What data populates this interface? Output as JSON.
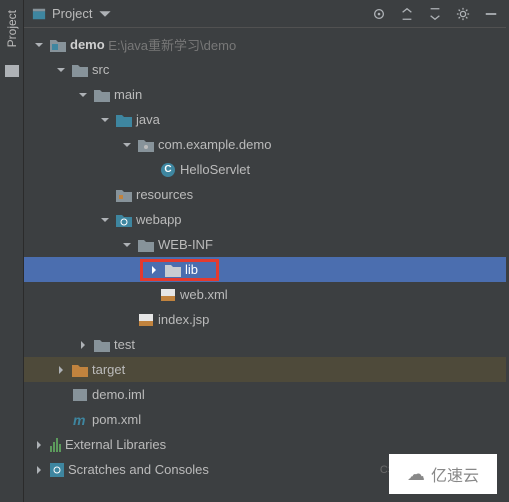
{
  "toolbar": {
    "title": "Project"
  },
  "tree": {
    "root": {
      "name": "demo",
      "path": "E:\\java重新学习\\demo"
    },
    "src": "src",
    "main": "main",
    "java": "java",
    "pkg": "com.example.demo",
    "servlet": "HelloServlet",
    "resources": "resources",
    "webapp": "webapp",
    "webinf": "WEB-INF",
    "lib": "lib",
    "webxml": "web.xml",
    "indexjsp": "index.jsp",
    "test": "test",
    "target": "target",
    "iml": "demo.iml",
    "pom": "pom.xml",
    "extlib": "External Libraries",
    "scratches": "Scratches and Consoles"
  },
  "watermarks": {
    "csdn": "CSDN",
    "brand": "亿速云"
  },
  "sidebar": {
    "label": "Project"
  }
}
